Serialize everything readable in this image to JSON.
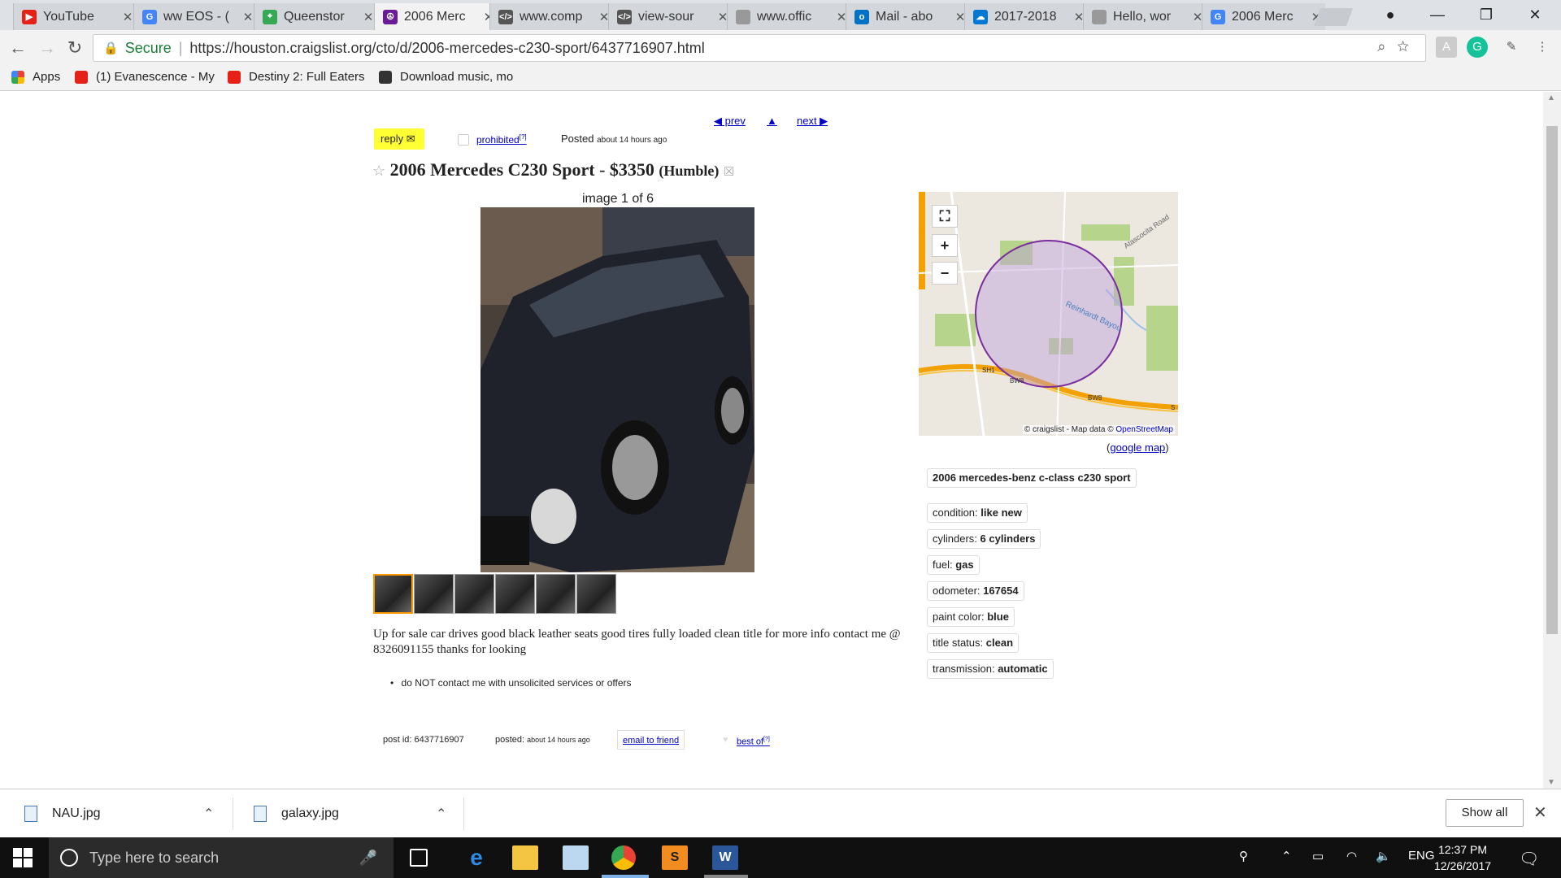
{
  "browser": {
    "tabs": [
      {
        "title": "YouTube",
        "color": "#e62117",
        "glyph": "▶"
      },
      {
        "title": "ww EOS - (",
        "color": "#4285f4",
        "glyph": "G"
      },
      {
        "title": "Queenstor",
        "color": "#34a853",
        "glyph": "⌖"
      },
      {
        "title": "2006 Merc",
        "color": "#6a1b9a",
        "glyph": "☮"
      },
      {
        "title": "www.comp",
        "color": "#555555",
        "glyph": "</>"
      },
      {
        "title": "view-sour",
        "color": "#555555",
        "glyph": "</>"
      },
      {
        "title": "www.offic",
        "color": "#999999",
        "glyph": ""
      },
      {
        "title": "Mail - abo",
        "color": "#0072c6",
        "glyph": "o"
      },
      {
        "title": "2017-2018",
        "color": "#0078d4",
        "glyph": "☁"
      },
      {
        "title": "Hello, wor",
        "color": "#999999",
        "glyph": ""
      },
      {
        "title": "2006 Merc",
        "color": "#4285f4",
        "glyph": "G"
      }
    ],
    "url_secure_label": "Secure",
    "url_separator": "|",
    "url": "https://houston.craigslist.org/cto/d/2006-mercedes-c230-sport/6437716907.html",
    "bookmarks": [
      {
        "label": "Apps"
      },
      {
        "label": "(1) Evanescence - My"
      },
      {
        "label": "Destiny 2: Full Eaters"
      },
      {
        "label": "Download music, mo"
      }
    ]
  },
  "listing": {
    "prev": "◀ prev",
    "up": "▲",
    "next": "next ▶",
    "reply": "reply ✉",
    "prohibited": "prohibited",
    "help_mark": "[?]",
    "posted_label": "Posted",
    "posted_time": "about 14 hours ago",
    "title": "2006 Mercedes C230 Sport",
    "title_sep": " - ",
    "price": "$3350",
    "location": "(Humble)",
    "image_count": "image 1 of 6",
    "description": "Up for sale car drives good black leather seats good tires fully loaded clean title for more info contact me @ 8326091155 thanks for looking",
    "notice": "do NOT contact me with unsolicited services or offers",
    "post_id_label": "post id:",
    "post_id": "6437716907",
    "posted_footer_label": "posted:",
    "posted_footer_time": "about 14 hours ago",
    "email_friend": "email to friend",
    "best_of": "best of",
    "heart": "♥",
    "google_map": "google map",
    "google_map_open": "(",
    "google_map_close": ")"
  },
  "map": {
    "expand": "⛶",
    "zoom_in": "+",
    "zoom_out": "−",
    "attribution_prefix": "© craigslist - Map data ©",
    "attribution_link": "OpenStreetMap",
    "labels": {
      "road1": "Atascocita Road",
      "bayou": "Reinhardt Bayou",
      "sh1": "SH1",
      "bw8": "BW8",
      "bw8b": "BW8",
      "s": "S"
    }
  },
  "attributes": {
    "model": "2006 mercedes-benz c-class c230 sport",
    "items": [
      {
        "label": "condition:",
        "value": "like new"
      },
      {
        "label": "cylinders:",
        "value": "6 cylinders"
      },
      {
        "label": "fuel:",
        "value": "gas"
      },
      {
        "label": "odometer:",
        "value": "167654"
      },
      {
        "label": "paint color:",
        "value": "blue"
      },
      {
        "label": "title status:",
        "value": "clean"
      },
      {
        "label": "transmission:",
        "value": "automatic"
      }
    ]
  },
  "downloads": {
    "files": [
      {
        "name": "NAU.jpg"
      },
      {
        "name": "galaxy.jpg"
      }
    ],
    "show_all": "Show all"
  },
  "taskbar": {
    "search_placeholder": "Type here to search",
    "lang": "ENG",
    "time": "12:37 PM",
    "date": "12/26/2017"
  }
}
